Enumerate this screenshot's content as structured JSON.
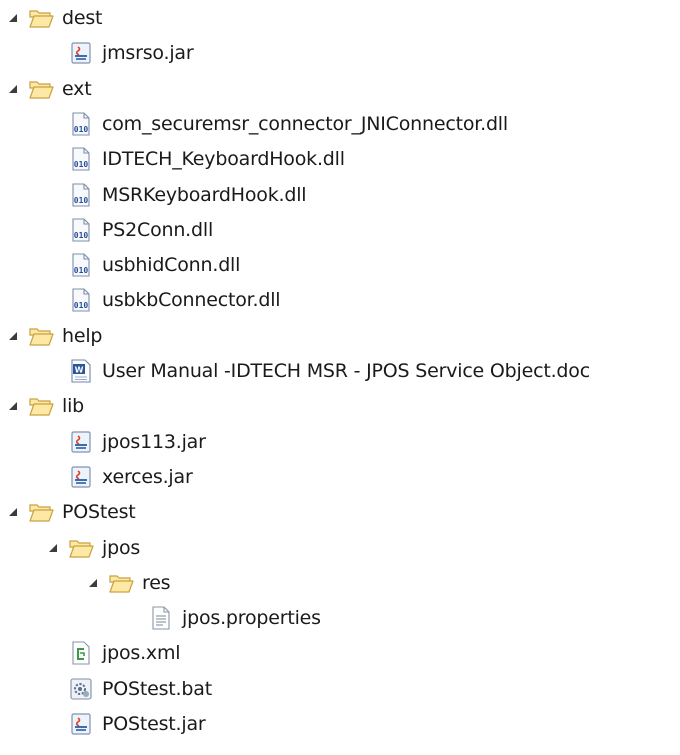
{
  "tree": {
    "nodes": [
      {
        "label": "dest",
        "icon": "folder-open-icon",
        "expanded": true,
        "depth": 0
      },
      {
        "label": "jmsrso.jar",
        "icon": "jar-file-icon",
        "depth": 1
      },
      {
        "label": "ext",
        "icon": "folder-open-icon",
        "expanded": true,
        "depth": 0
      },
      {
        "label": "com_securemsr_connector_JNIConnector.dll",
        "icon": "binary-file-icon",
        "depth": 1
      },
      {
        "label": "IDTECH_KeyboardHook.dll",
        "icon": "binary-file-icon",
        "depth": 1
      },
      {
        "label": "MSRKeyboardHook.dll",
        "icon": "binary-file-icon",
        "depth": 1
      },
      {
        "label": "PS2Conn.dll",
        "icon": "binary-file-icon",
        "depth": 1
      },
      {
        "label": "usbhidConn.dll",
        "icon": "binary-file-icon",
        "depth": 1
      },
      {
        "label": "usbkbConnector.dll",
        "icon": "binary-file-icon",
        "depth": 1
      },
      {
        "label": "help",
        "icon": "folder-open-icon",
        "expanded": true,
        "depth": 0
      },
      {
        "label": "User Manual -IDTECH MSR - JPOS Service Object.doc",
        "icon": "word-document-icon",
        "depth": 1
      },
      {
        "label": "lib",
        "icon": "folder-open-icon",
        "expanded": true,
        "depth": 0
      },
      {
        "label": "jpos113.jar",
        "icon": "jar-file-icon",
        "depth": 1
      },
      {
        "label": "xerces.jar",
        "icon": "jar-file-icon",
        "depth": 1
      },
      {
        "label": "POStest",
        "icon": "folder-open-icon",
        "expanded": true,
        "depth": 0
      },
      {
        "label": "jpos",
        "icon": "folder-open-icon",
        "expanded": true,
        "depth": 1
      },
      {
        "label": "res",
        "icon": "folder-open-icon",
        "expanded": true,
        "depth": 2
      },
      {
        "label": "jpos.properties",
        "icon": "text-file-icon",
        "depth": 3
      },
      {
        "label": "jpos.xml",
        "icon": "xml-file-icon",
        "depth": 1
      },
      {
        "label": "POStest.bat",
        "icon": "batch-file-icon",
        "depth": 1
      },
      {
        "label": "POStest.jar",
        "icon": "jar-file-icon",
        "depth": 1
      }
    ]
  },
  "colors": {
    "folder_fill": "#fde8a6",
    "folder_stroke": "#c9a13d",
    "arrow": "#3c3c3c",
    "jar_red": "#d9412b",
    "jar_blue": "#2a5da8",
    "binary_blue": "#2a4f9e",
    "word_blue": "#2b579a",
    "xml_green": "#3a9a4a",
    "text_gray": "#7a8796"
  }
}
